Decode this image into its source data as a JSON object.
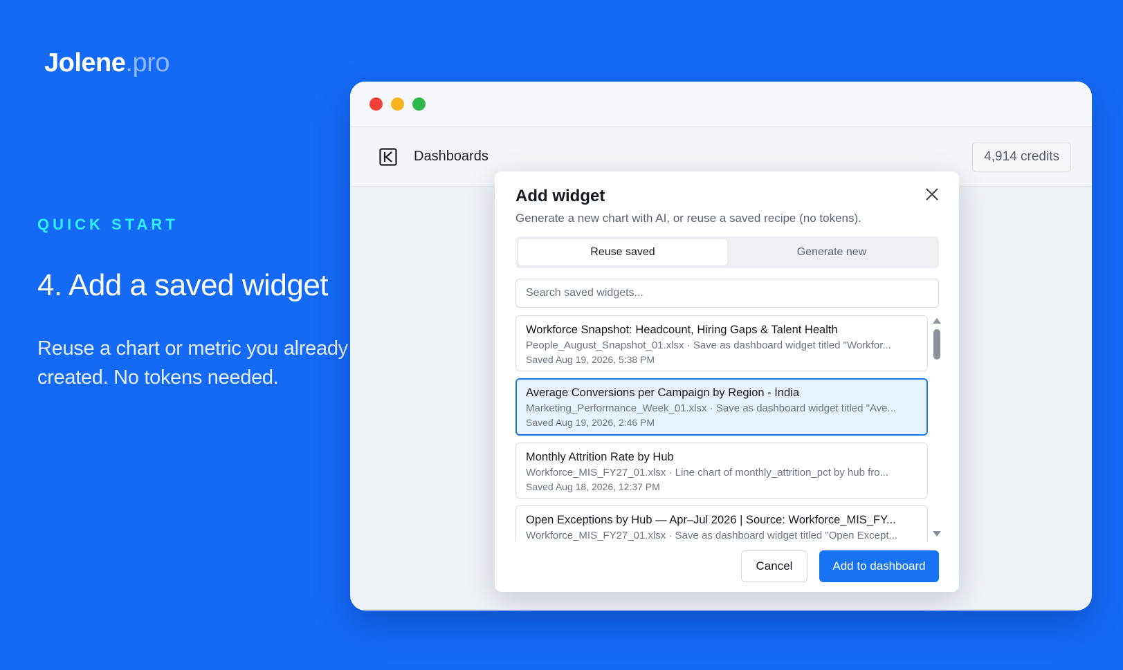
{
  "brand": {
    "name": "Jolene",
    "tld": ".pro"
  },
  "hero": {
    "eyebrow": "QUICK START",
    "headline": "4. Add a saved widget",
    "subcopy": "Reuse a chart or metric you already created. No tokens needed."
  },
  "window": {
    "app_title": "Dashboards",
    "credits": "4,914 credits"
  },
  "modal": {
    "title": "Add widget",
    "subtitle": "Generate a new chart with AI, or reuse a saved recipe (no tokens).",
    "tabs": [
      {
        "label": "Reuse saved",
        "active": true
      },
      {
        "label": "Generate new",
        "active": false
      }
    ],
    "search": {
      "placeholder": "Search saved widgets...",
      "value": ""
    },
    "items": [
      {
        "title": "Workforce Snapshot: Headcount, Hiring Gaps & Talent Health",
        "desc": "People_August_Snapshot_01.xlsx · Save as dashboard widget titled \"Workfor...",
        "date": "Saved Aug 19, 2026, 5:38 PM",
        "selected": false
      },
      {
        "title": "Average Conversions per Campaign by Region - India",
        "desc": "Marketing_Performance_Week_01.xlsx · Save as dashboard widget titled \"Ave...",
        "date": "Saved Aug 19, 2026, 2:46 PM",
        "selected": true
      },
      {
        "title": "Monthly Attrition Rate by Hub",
        "desc": "Workforce_MIS_FY27_01.xlsx · Line chart of monthly_attrition_pct by hub fro...",
        "date": "Saved Aug 18, 2026, 12:37 PM",
        "selected": false
      },
      {
        "title": "Open Exceptions by Hub — Apr–Jul 2026 | Source: Workforce_MIS_FY...",
        "desc": "Workforce_MIS_FY27_01.xlsx · Save as dashboard widget titled \"Open Except...",
        "date": "",
        "selected": false
      }
    ],
    "cancel_label": "Cancel",
    "primary_label": "Add to dashboard"
  },
  "colors": {
    "background": "#1469f5",
    "accent": "#1873f2",
    "eyebrow": "#2ff0ff",
    "selected_bg": "#e8f2ff"
  }
}
